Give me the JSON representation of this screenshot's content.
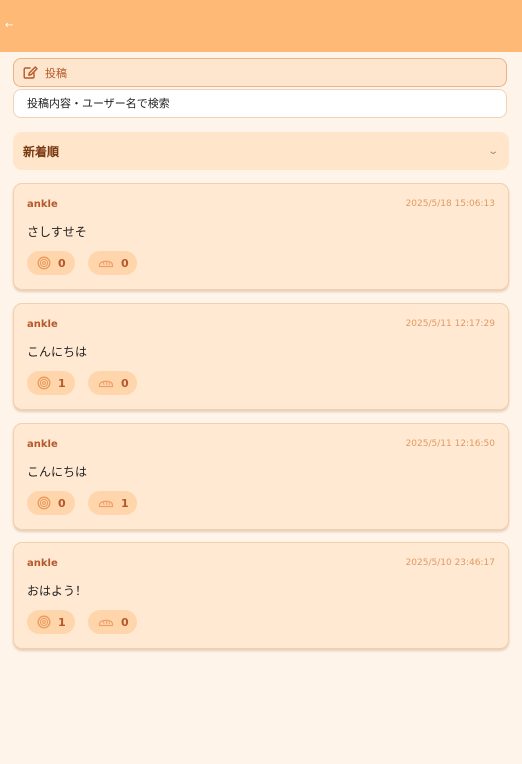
{
  "header": {
    "back_label": "←"
  },
  "toolbar": {
    "post_label": "投稿",
    "search_placeholder": "投稿内容・ユーザー名で検索",
    "sort_label": "新着順",
    "sort_chevron": "⌄"
  },
  "posts": [
    {
      "username": "ankle",
      "timestamp": "2025/5/18 15:06:13",
      "content": "さしすせそ",
      "reaction1_count": "0",
      "reaction2_count": "0"
    },
    {
      "username": "ankle",
      "timestamp": "2025/5/11 12:17:29",
      "content": "こんにちは",
      "reaction1_count": "1",
      "reaction2_count": "0"
    },
    {
      "username": "ankle",
      "timestamp": "2025/5/11 12:16:50",
      "content": "こんにちは",
      "reaction1_count": "0",
      "reaction2_count": "1"
    },
    {
      "username": "ankle",
      "timestamp": "2025/5/10 23:46:17",
      "content": "おはよう！",
      "reaction1_count": "1",
      "reaction2_count": "0"
    }
  ],
  "icons": {
    "post": "edit-icon",
    "reaction1": "bagel-icon",
    "reaction2": "bread-icon"
  },
  "colors": {
    "header": "#ffb976",
    "background": "#fff4ea",
    "card": "#ffe9d3",
    "accent": "#b5582a",
    "timestamp": "#e29a62"
  }
}
